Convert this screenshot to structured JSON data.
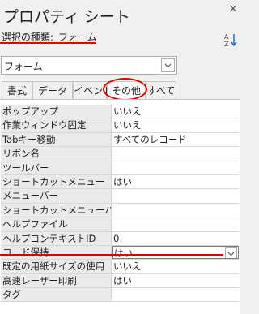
{
  "window": {
    "title": "プロパティ シート",
    "close_icon": "×"
  },
  "selection": {
    "label": "選択の種類:",
    "value": "フォーム"
  },
  "object_select": {
    "value": "フォーム"
  },
  "tabs": [
    {
      "label": "書式"
    },
    {
      "label": "データ"
    },
    {
      "label": "イベント"
    },
    {
      "label": "その他",
      "active": true
    },
    {
      "label": "すべて"
    }
  ],
  "properties": [
    {
      "label": "ポップアップ",
      "value": "いいえ"
    },
    {
      "label": "作業ウィンドウ固定",
      "value": "いいえ"
    },
    {
      "label": "Tabキー移動",
      "value": "すべてのレコード"
    },
    {
      "label": "リボン名",
      "value": ""
    },
    {
      "label": "ツールバー",
      "value": ""
    },
    {
      "label": "ショートカットメニュー",
      "value": "はい"
    },
    {
      "label": "メニューバー",
      "value": ""
    },
    {
      "label": "ショートカットメニューバー",
      "value": ""
    },
    {
      "label": "ヘルプファイル",
      "value": ""
    },
    {
      "label": "ヘルプコンテキストID",
      "value": "0"
    },
    {
      "label": "コード保持",
      "value": "はい",
      "selected": true
    },
    {
      "label": "既定の用紙サイズの使用",
      "value": "いいえ"
    },
    {
      "label": "高速レーザー印刷",
      "value": "はい"
    },
    {
      "label": "タグ",
      "value": ""
    }
  ],
  "colors": {
    "highlight": "#e00000",
    "label_bg": "#eaeaea"
  }
}
